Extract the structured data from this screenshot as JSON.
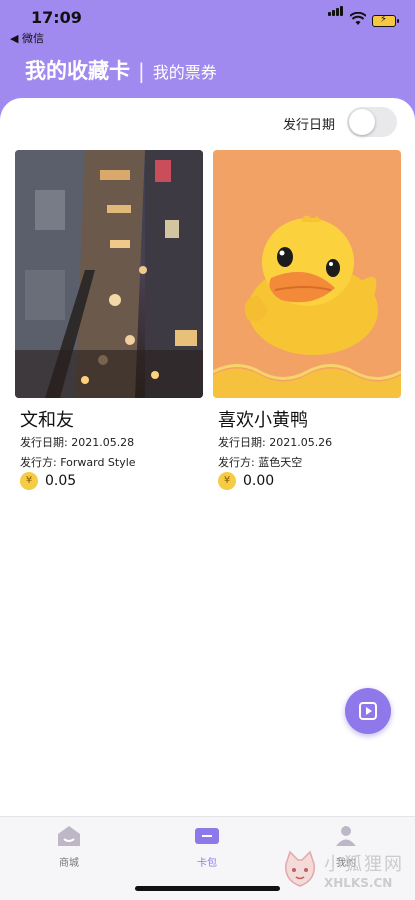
{
  "status_bar": {
    "time": "17:09",
    "back_label": "◀ 微信"
  },
  "header": {
    "title": "我的收藏卡",
    "separator": "|",
    "secondary_tab": "我的票券"
  },
  "filter": {
    "label": "发行日期",
    "toggle_on": false
  },
  "cards": [
    {
      "name": "文和友",
      "date": "发行日期: 2021.05.28",
      "issuer": "发行方: Forward Style",
      "currency": "¥",
      "price": "0.05"
    },
    {
      "name": "喜欢小黄鸭",
      "date": "发行日期: 2021.05.26",
      "issuer": "发行方: 蓝色天空",
      "currency": "¥",
      "price": "0.00"
    }
  ],
  "tabbar": {
    "items": [
      {
        "label": "商城",
        "icon": "shop-icon"
      },
      {
        "label": "卡包",
        "icon": "card-wallet-icon"
      },
      {
        "label": "我的",
        "icon": "profile-icon"
      }
    ]
  },
  "watermark": {
    "cn": "小狐狸网",
    "en": "XHLKS.CN"
  },
  "colors": {
    "accent": "#a08aef",
    "fab": "#8f78ea",
    "coin": "#f4cc45",
    "duck_bg": "#f3a266"
  }
}
